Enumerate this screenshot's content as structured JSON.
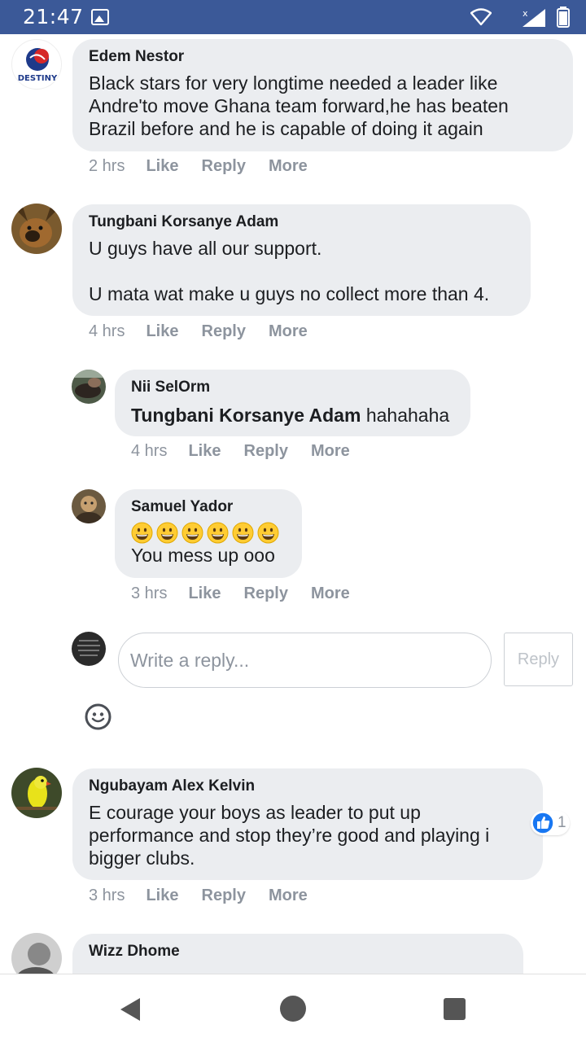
{
  "status_bar": {
    "time": "21:47",
    "icons": [
      "gallery-icon",
      "wifi-icon",
      "signal-icon",
      "battery-icon"
    ]
  },
  "comments": [
    {
      "author": "Edem Nestor",
      "avatar_badge": "DESTINY",
      "text": "Black stars for very longtime needed a leader like Andre'to move Ghana team forward,he has beaten Brazil before and he is capable of doing it again",
      "time": "2 hrs",
      "actions": [
        "Like",
        "Reply",
        "More"
      ]
    },
    {
      "author": "Tungbani Korsanye Adam",
      "text": "U guys have all our support.\n\nU mata wat make u guys no collect more than 4.",
      "time": "4 hrs",
      "actions": [
        "Like",
        "Reply",
        "More"
      ],
      "replies": [
        {
          "author": "Nii SelOrm",
          "mention": "Tungbani Korsanye Adam",
          "text": "hahahaha",
          "time": "4 hrs",
          "actions": [
            "Like",
            "Reply",
            "More"
          ]
        },
        {
          "author": "Samuel Yador",
          "emoji_count": 6,
          "text": "You mess up ooo",
          "time": "3 hrs",
          "actions": [
            "Like",
            "Reply",
            "More"
          ]
        }
      ],
      "reply_box": {
        "placeholder": "Write a reply...",
        "button": "Reply"
      }
    },
    {
      "author": "Ngubayam Alex Kelvin",
      "text": "E courage your boys as leader to put up performance and stop they’re good and playing i bigger clubs.",
      "time": "3 hrs",
      "actions": [
        "Like",
        "Reply",
        "More"
      ],
      "reaction": {
        "icon": "like-icon",
        "count": "1"
      }
    },
    {
      "author": "Wizz Dhome"
    }
  ],
  "colors": {
    "status_bar": "#3b5998",
    "bubble": "#ebedf0",
    "meta_text": "#8d949e",
    "like_blue": "#1877f2"
  }
}
